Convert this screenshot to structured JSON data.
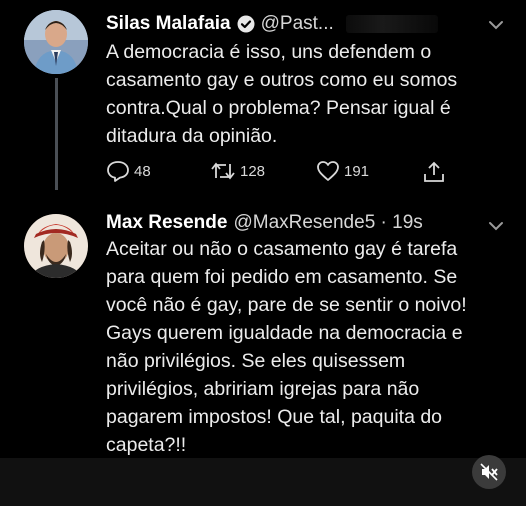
{
  "tweets": [
    {
      "name": "Silas Malafaia",
      "handle": "@Past...",
      "verified": true,
      "text": "A democracia é isso, uns defendem o\ncasamento gay e outros como eu somos\ncontra.Qual o problema? Pensar igual é\nditadura da opinião.",
      "replies": "48",
      "retweets": "128",
      "likes": "191"
    },
    {
      "name": "Max Resende",
      "handle": "@MaxResende5 · 19s",
      "text": "Aceitar ou não o casamento gay é tarefa\npara quem foi pedido em casamento. Se\nvocê não é gay, pare de se sentir o noivo!\nGays querem igualdade na democracia e\nnão privilégios. Se eles quisessem\nprivilégios, abririam igrejas para não\npagarem impostos! Que tal, paquita do\ncapeta?!!"
    }
  ],
  "icons": {
    "verified": "verified-badge-icon",
    "chevron": "chevron-down-icon",
    "reply": "reply-bubble-icon",
    "retweet": "retweet-arrows-icon",
    "like": "heart-icon",
    "share": "share-upload-icon",
    "mute": "speaker-muted-icon"
  },
  "colors": {
    "background": "#000000",
    "text": "#ececec",
    "secondary": "#d6d6d6",
    "thread_line": "#4a4f55"
  }
}
